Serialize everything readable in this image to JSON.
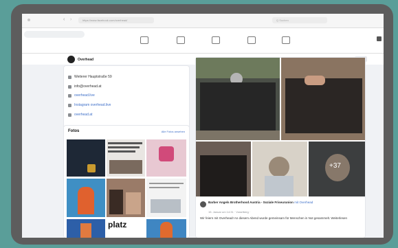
{
  "browser": {
    "url": "https://www.facebook.com/overhead/",
    "search_placeholder": "Q Suchen"
  },
  "profile": {
    "name": "Overhead",
    "follow_button": "Abo",
    "info": [
      {
        "icon": "home-icon",
        "text": "Weiterer Hauptstraße 59",
        "link": false
      },
      {
        "icon": "mail-icon",
        "text": "info@overhead.at",
        "link": false
      },
      {
        "icon": "globe-icon",
        "text": "overhead.live",
        "link": true
      },
      {
        "icon": "link-icon",
        "text": "Instagram overhead.live",
        "link": true
      },
      {
        "icon": "tag-icon",
        "text": "overhead.at",
        "link": true
      }
    ]
  },
  "photos": {
    "title": "Fotos",
    "see_all": "Alle Fotos ansehen",
    "grid_text_snippet": "platz"
  },
  "post": {
    "author": "Barber Angels Brotherhood Austria - Soziale Friseurunion",
    "with": "mit Overhead",
    "meta": "15. Januar um 14:31 · Vorarlberg ·",
    "text": "Wir feiern mit Overhead! An diesem Abend wurde gemeinsam für Menschen in Not gesammelt. Weiterlesen",
    "more_photos": "+37"
  },
  "colors": {
    "background": "#5a9e99",
    "device": "#5d5d5d",
    "link": "#3c6ec8"
  }
}
